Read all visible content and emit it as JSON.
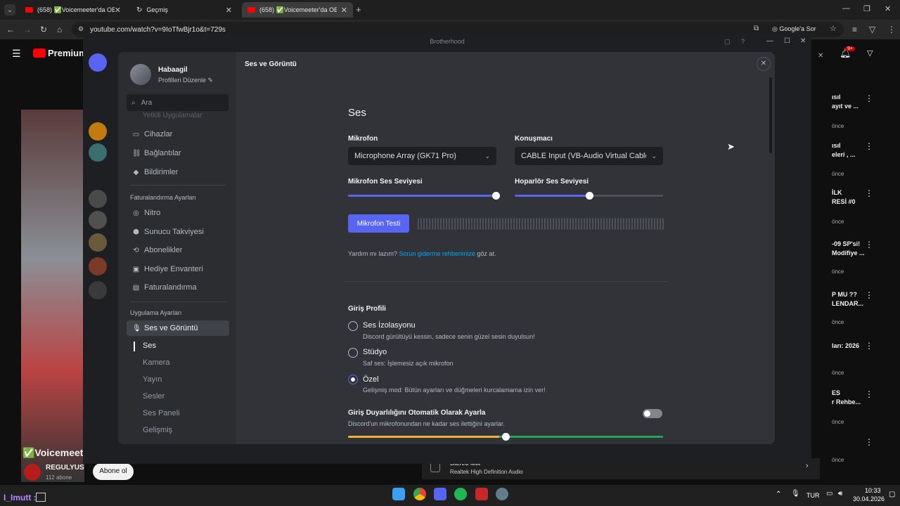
{
  "browser": {
    "tabs": [
      {
        "label": "(658) ✅Voicemeeter'da OBS, D"
      },
      {
        "label": "Geçmiş"
      },
      {
        "label": "(658) ✅Voicemeeter'da OBS, D"
      }
    ],
    "url": "youtube.com/watch?v=9IoTfwBjr1o&t=729s",
    "google_ask": "Google'a Sor"
  },
  "youtube": {
    "logo": "Premium",
    "notif_badge": "9+",
    "video_title": "✅Voicemeete",
    "channel": "REGULYUS",
    "subscribers": "112 abone",
    "subscribe_label": "Abone ol",
    "sidebar_videos": [
      {
        "title1": "ısıl",
        "title2": "ayıt ve ...",
        "meta": "önce"
      },
      {
        "title1": "ısıl",
        "title2": "eleri , ...",
        "meta": "önce"
      },
      {
        "title1": "İLK",
        "title2": "RESİ #0",
        "meta": "önce"
      },
      {
        "title1": "-09 SP'si!",
        "title2": "Modifiye ...",
        "meta": "önce"
      },
      {
        "title1": "P MU ??",
        "title2": "LENDAR...",
        "meta": "önce"
      },
      {
        "title1": "ları: 2026",
        "title2": "",
        "meta": "önce"
      },
      {
        "title1": "ES",
        "title2": "r Rehbe...",
        "meta": "önce"
      },
      {
        "title1": "",
        "title2": "",
        "meta": "önce"
      }
    ],
    "audio_device_title": "Stereo Mix",
    "audio_device_sub": "Realtek High Definition Audio"
  },
  "discord": {
    "window_title": "Brotherhood",
    "profile": {
      "name": "Habaagil",
      "edit_label": "Profilleri Düzenle"
    },
    "search_placeholder": "Ara",
    "nav_faded": "Yetkili Uygulamalar",
    "nav_user": [
      {
        "label": "Cihazlar",
        "icon": "devices-icon"
      },
      {
        "label": "Bağlantılar",
        "icon": "link-icon"
      },
      {
        "label": "Bildirimler",
        "icon": "bell-icon"
      }
    ],
    "billing_header": "Faturalandırma Ayarları",
    "nav_billing": [
      {
        "label": "Nitro",
        "icon": "nitro-icon"
      },
      {
        "label": "Sunucu Takviyesi",
        "icon": "boost-icon"
      },
      {
        "label": "Abonelikler",
        "icon": "subscriptions-icon"
      },
      {
        "label": "Hediye Envanteri",
        "icon": "gift-icon"
      },
      {
        "label": "Faturalandırma",
        "icon": "billing-icon"
      }
    ],
    "app_header": "Uygulama Ayarları",
    "nav_app_active": "Ses ve Görüntü",
    "sub_items": [
      "Ses",
      "Kamera",
      "Yayın",
      "Sesler",
      "Ses Paneli",
      "Gelişmiş"
    ],
    "content_header": "Ses ve Görüntü",
    "section_title": "Ses",
    "mic_label": "Mikrofon",
    "mic_value": "Microphone Array (GK71 Pro)",
    "speaker_label": "Konuşmacı",
    "speaker_value": "CABLE Input (VB-Audio Virtual Cable)",
    "mic_volume_label": "Mikrofon Ses Seviyesi",
    "mic_volume_level": 1.0,
    "speaker_volume_label": "Hoparlör Ses Seviyesi",
    "speaker_volume_level": 0.5,
    "mic_test_label": "Mikrofon Testi",
    "help_prefix": "Yardım mı lazım? ",
    "help_link": "Sorun giderme rehberimize",
    "help_suffix": " göz at.",
    "input_profile_title": "Giriş Profili",
    "profiles": [
      {
        "title": "Ses İzolasyonu",
        "desc": "Discord gürültüyü kessin, sadece senin güzel sesin duyulsun!",
        "selected": false
      },
      {
        "title": "Stüdyo",
        "desc": "Saf ses: İşlemesiz açık mikrofon",
        "selected": false
      },
      {
        "title": "Özel",
        "desc": "Gelişmiş mod: Bütün ayarları ve düğmeleri kurcalamama izin ver!",
        "selected": true
      }
    ],
    "auto_sens_title": "Giriş Duyarlılığını Otomatik Olarak Ayarla",
    "auto_sens_desc": "Discord'un mikrofonundan ne kadar ses ilettiğini ayarlar.",
    "auto_sens_enabled": false,
    "sensitivity_level": 0.5,
    "accent": "#5865f2"
  },
  "taskbar": {
    "user_tag": "I_Imutt :",
    "language": "TUR",
    "time": "10:33",
    "date": "30.04.2026"
  }
}
